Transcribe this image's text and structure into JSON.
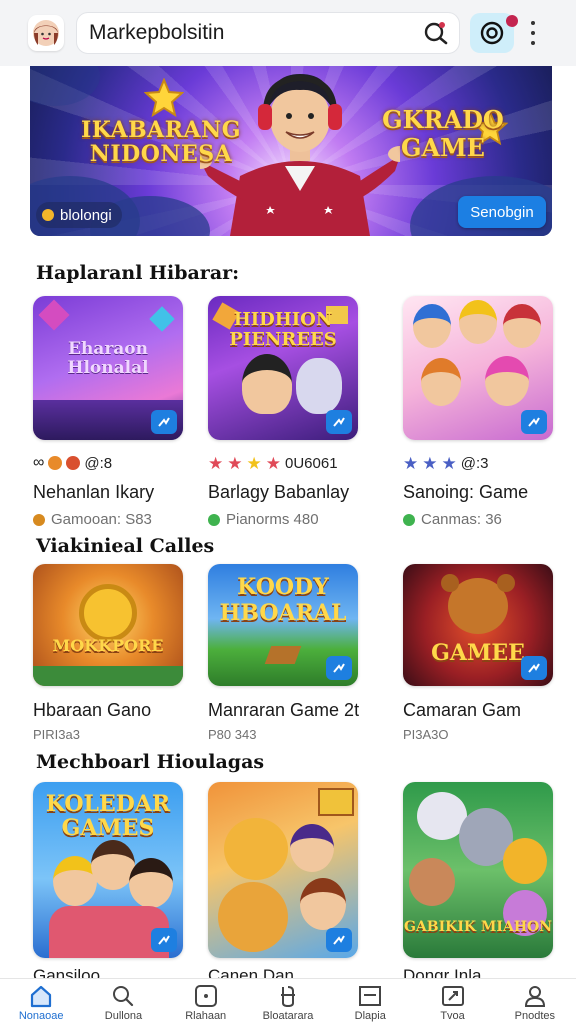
{
  "search": {
    "value": "Markepbolsitin"
  },
  "banner": {
    "headline_left": "IKABARANG NIDONESA",
    "headline_right": "GKRADO GAME",
    "tag": "blolongi",
    "cta": "Senobgin"
  },
  "sections": [
    {
      "title": "Haplaranl Hibarar:",
      "cards": [
        {
          "thumb_text": "Eharaon Hlonalal",
          "rating": "@:8",
          "title": "Nehanlan Ikary",
          "sub": "Gamooan: S83"
        },
        {
          "thumb_text": "HIDHION PIENREES",
          "rating": "0U6061",
          "title": "Barlagy Babanlay",
          "sub": "Pianorms 480"
        },
        {
          "thumb_text": "",
          "rating": "@:3",
          "title": "Sanoing: Game",
          "sub": "Canmas: 36"
        }
      ]
    },
    {
      "title": "Viakinieal Calles",
      "cards": [
        {
          "thumb_text": "MOKKPORE",
          "title": "Hbaraan Gano",
          "sub": "PIRI3a3"
        },
        {
          "thumb_text": "KOODY HBOARAL",
          "title": "Manraran Game 2t",
          "sub": "P80 343"
        },
        {
          "thumb_text": "GAMEE",
          "title": "Camaran Gam",
          "sub": "PI3A3O"
        }
      ]
    },
    {
      "title": "Mechboarl Hioulagas",
      "cards": [
        {
          "thumb_text": "KOLEDAR GAMES",
          "title": "Gansiloo"
        },
        {
          "thumb_text": "",
          "title": "Canen Dan"
        },
        {
          "thumb_text": "GABIKIK MIAHON",
          "title": "Dongr Inla"
        }
      ]
    }
  ],
  "bottom_nav": [
    {
      "label": "Nonaoae",
      "icon": "home-icon"
    },
    {
      "label": "Dullona",
      "icon": "search-icon"
    },
    {
      "label": "Rlahaan",
      "icon": "game-icon"
    },
    {
      "label": "Bloatarara",
      "icon": "payments-icon"
    },
    {
      "label": "Dlapia",
      "icon": "library-icon"
    },
    {
      "label": "Tvoa",
      "icon": "tools-icon"
    },
    {
      "label": "Pnodtes",
      "icon": "profile-icon"
    }
  ],
  "colors": {
    "accent": "#1e7fe0",
    "topbar": "#f3f4f6",
    "badge": "#c3244f"
  }
}
